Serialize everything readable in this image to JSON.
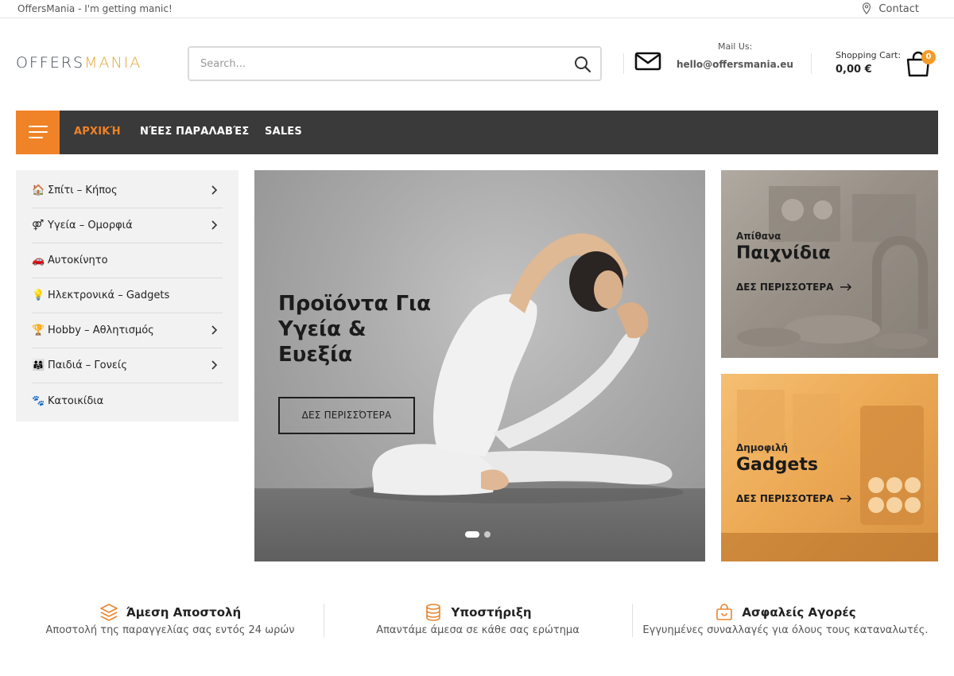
{
  "topbar": {
    "tagline": "OffersMania - I'm getting manic!",
    "contact_label": "Contact"
  },
  "header": {
    "logo_part1": "OFFERS",
    "logo_part2": "MANIA",
    "search_placeholder": "Search...",
    "mail_label": "Mail Us:",
    "mail_address": "hello@offersmania.eu",
    "cart_label": "Shopping Cart:",
    "cart_total": "0,00 €",
    "cart_count": "0"
  },
  "nav": {
    "items": [
      {
        "label": "ΑΡΧΙΚΉ",
        "active": true
      },
      {
        "label": "ΝΈΕΣ ΠΑΡΑΛΑΒΈΣ",
        "active": false
      },
      {
        "label": "SALES",
        "active": false
      }
    ]
  },
  "categories": [
    {
      "emoji": "🏠",
      "label": "Σπίτι – Κήπος",
      "has_children": true
    },
    {
      "emoji": "⚤",
      "label": "Υγεία – Ομορφιά",
      "has_children": true
    },
    {
      "emoji": "🚗",
      "label": "Αυτοκίνητο",
      "has_children": false
    },
    {
      "emoji": "💡",
      "label": "Ηλεκτρονικά – Gadgets",
      "has_children": false
    },
    {
      "emoji": "🏆",
      "label": "Hobby – Αθλητισμός",
      "has_children": true
    },
    {
      "emoji": "👨‍👩‍👧",
      "label": "Παιδιά – Γονείς",
      "has_children": true
    },
    {
      "emoji": "🐾",
      "label": "Κατοικίδια",
      "has_children": false
    }
  ],
  "hero": {
    "title": "Προϊόντα Για Υγεία & Ευεξία",
    "cta": "ΔΕΣ ΠΕΡΙΣΣΌΤΕΡΑ",
    "slides": 2,
    "active_slide": 1
  },
  "banners": [
    {
      "small": "Απίθανα",
      "big": "Παιχνίδια",
      "more": "ΔΕΣ ΠΕΡΙΣΣΟΤΕΡΑ"
    },
    {
      "small": "Δημοφιλή",
      "big": "Gadgets",
      "more": "ΔΕΣ ΠΕΡΙΣΣΟΤΕΡΑ"
    }
  ],
  "features": [
    {
      "icon": "layers-icon",
      "title": "Άμεση Αποστολή",
      "desc": "Αποστολή της παραγγελίας σας εντός 24 ωρών"
    },
    {
      "icon": "database-icon",
      "title": "Υποστήριξη",
      "desc": "Απαντάμε άμεσα σε κάθε σας ερώτημα"
    },
    {
      "icon": "shopping-bag-icon",
      "title": "Ασφαλείς Αγορές",
      "desc": "Εγγυημένες συναλλαγές για όλους τους καταναλωτές."
    }
  ],
  "colors": {
    "accent": "#f08227",
    "nav_bg": "#3a3a3a",
    "sidebar_bg": "#f2f2f2",
    "badge": "#f39c2b",
    "logo_grey": "#3a4350",
    "logo_gold": "#e3a63a"
  }
}
